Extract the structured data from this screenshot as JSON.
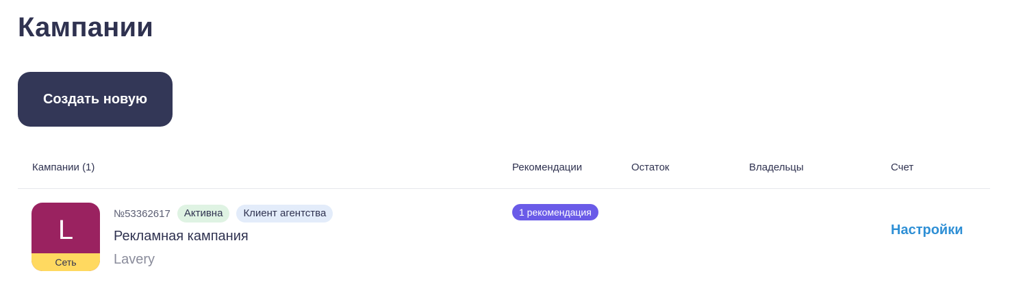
{
  "page": {
    "title": "Кампании",
    "create_button_label": "Создать новую"
  },
  "table": {
    "columns": {
      "campaigns": "Кампании (1)",
      "recommendations": "Рекомендации",
      "balance": "Остаток",
      "owners": "Владельцы",
      "account": "Счет"
    },
    "rows": [
      {
        "avatar_letter": "L",
        "avatar_tag": "Сеть",
        "id": "№53362617",
        "status": "Активна",
        "type": "Клиент агентства",
        "name": "Рекламная кампания",
        "client": "Lavery",
        "recommendations": "1 рекомендация",
        "account_link": "Настройки"
      }
    ]
  },
  "colors": {
    "primary_dark": "#333757",
    "avatar_bg": "#9a2260",
    "avatar_tag_bg": "#ffd960",
    "active_badge_bg": "#dff3e3",
    "agency_badge_bg": "#e3ecfa",
    "rec_badge_bg": "#6a5be8",
    "link": "#2e8fd5"
  }
}
